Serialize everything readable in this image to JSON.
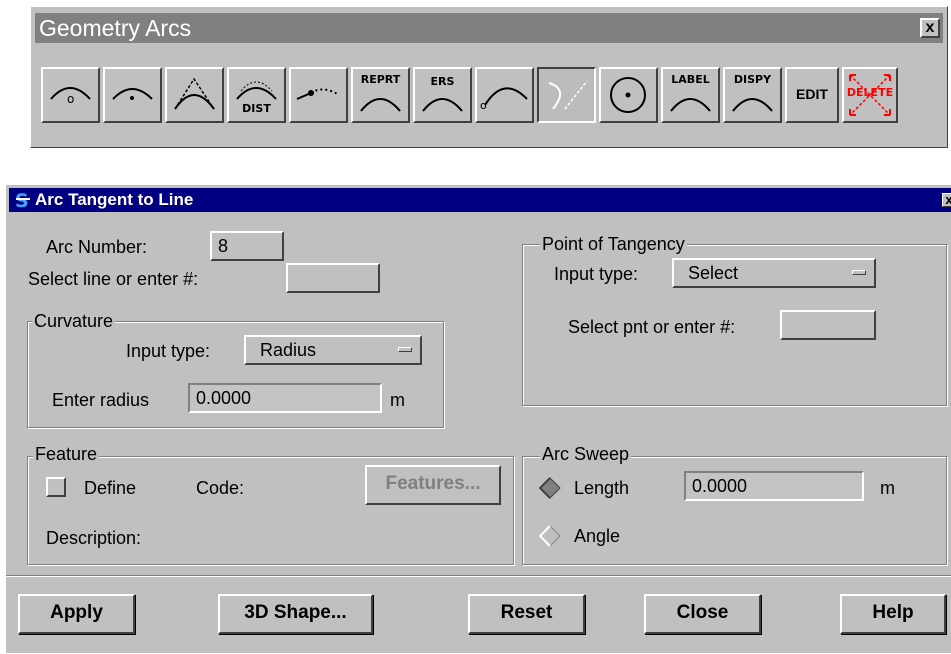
{
  "palette": {
    "title": "Geometry Arcs",
    "close_glyph": "x",
    "buttons": [
      {
        "name": "arc-tool-1-button",
        "icon": "arc-center-point-icon",
        "label": ""
      },
      {
        "name": "arc-tool-2-button",
        "icon": "arc-flat-point-icon",
        "label": ""
      },
      {
        "name": "arc-tool-3-button",
        "icon": "arc-three-point-icon",
        "label": ""
      },
      {
        "name": "arc-dist-button",
        "icon": "arc-dist-icon",
        "label": "DIST"
      },
      {
        "name": "arc-tool-5-button",
        "icon": "arc-dotted-line-icon",
        "label": ""
      },
      {
        "name": "arc-reprt-button",
        "icon": "arc-report-icon",
        "label": "REPRT"
      },
      {
        "name": "arc-ers-button",
        "icon": "arc-erase-icon",
        "label": "ERS"
      },
      {
        "name": "arc-tool-8-button",
        "icon": "arc-from-point-icon",
        "label": ""
      },
      {
        "name": "arc-tangent-line-button",
        "icon": "arc-tangent-line-icon",
        "label": ""
      },
      {
        "name": "circle-button",
        "icon": "circle-icon",
        "label": ""
      },
      {
        "name": "arc-label-button",
        "icon": "arc-label-icon",
        "label": "LABEL"
      },
      {
        "name": "arc-dispy-button",
        "icon": "arc-display-icon",
        "label": "DISPY"
      },
      {
        "name": "edit-button",
        "icon": "edit-icon",
        "label": "EDIT"
      },
      {
        "name": "delete-button",
        "icon": "delete-icon",
        "label": "DELETE"
      }
    ],
    "delete_color": "#ff0000"
  },
  "dialog": {
    "title": "Arc Tangent to Line",
    "close_glyph": "x",
    "arc_number_label": "Arc Number:",
    "arc_number_value": "8",
    "select_line_label": "Select line or enter #:",
    "select_line_value": "",
    "curvature": {
      "title": "Curvature",
      "input_type_label": "Input type:",
      "input_type_value": "Radius",
      "radius_label": "Enter radius",
      "radius_value": "0.0000",
      "radius_unit": "m"
    },
    "tangency": {
      "title": "Point of Tangency",
      "input_type_label": "Input type:",
      "input_type_value": "Select",
      "select_pnt_label": "Select pnt or enter #:",
      "select_pnt_value": ""
    },
    "feature": {
      "title": "Feature",
      "define_label": "Define",
      "code_label": "Code:",
      "features_button": "Features...",
      "description_label": "Description:"
    },
    "arc_sweep": {
      "title": "Arc Sweep",
      "length_label": "Length",
      "length_value": "0.0000",
      "length_unit": "m",
      "angle_label": "Angle",
      "selected": "Length"
    },
    "buttons": {
      "apply": "Apply",
      "shape3d": "3D Shape...",
      "reset": "Reset",
      "close": "Close",
      "help": "Help"
    },
    "title_bar_color": "#000080"
  }
}
